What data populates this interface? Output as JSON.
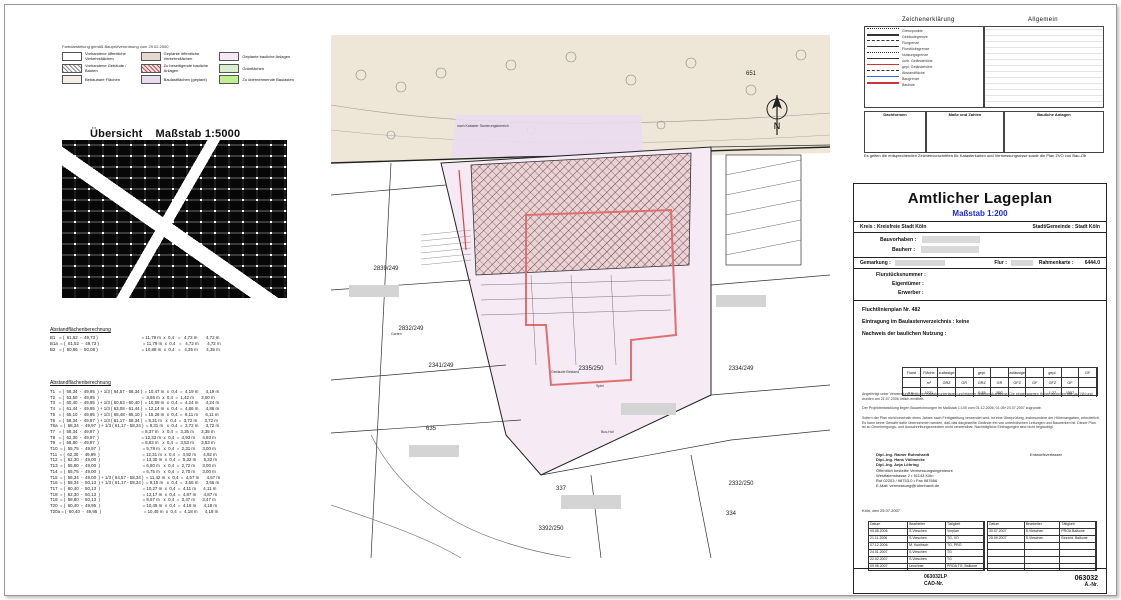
{
  "legend_left": {
    "header": "Farbdarstellung gemäß Bauprüfverordnung vom 29.02.2000",
    "items": [
      "Vorhandene öffentliche Verkehrsflächen",
      "Geplante öffentliche Verkehrsflächen",
      "Geplante bauliche Anlagen",
      "Vorhandene Gebäude / Bauten",
      "Zu beseitigende bauliche Anlagen",
      "Grünflächen",
      "Bebaubare Flächen",
      "Baulastflächen (geplant)",
      "Zu übernehmende Baulasten"
    ]
  },
  "overview": {
    "title": "Übersicht    Maßstab 1:5000"
  },
  "calc1": {
    "title": "Abstandflächenberechnung",
    "rows": [
      "B1   = (  61,52  -  49,73 )                                    = 11,79 m  x  0,4   =   4,72 m       4,72 m",
      "B1a  = (  61,52  -  49,73 )                                    = 11,79 m  x  0,4   =   4,72 m       4,72 m",
      "B2   = (  60,96  -  50,08 )                                    = 10,88 m  x  0,4   =   4,35 m       4,35 m"
    ]
  },
  "calc2": {
    "title": "Abstandflächenberechnung",
    "rows": [
      "T1   = (  58,34  -  49,95  ) + 1/3 ( 64,57 - 58,34 )  = 10,47 m  x  0,4  =  4,19 m      4,19 m",
      "T2   = (  53,50  -  49,95  )                                   =  3,55 m  x  0,4  =  1,42 m      3,00 m",
      "T3   = (  60,40  -  49,95  ) + 1/3 ( 60,63 - 60,40 )  = 10,59 m  x  0,4  =  4,24 m      4,24 m",
      "T4   = (  61,44  -  49,95  ) + 1/3 ( 63,08 - 61,44 )  = 12,14 m  x  0,4  =  4,86 m      4,86 m",
      "T5   = (  65,10  -  49,95  ) + 1/3 ( 65,48 - 65,10 )  = 15,28 m  x  0,4  =  6,11 m      6,11 m",
      "T6   = (  58,34  -  49,97  ) + 1/3 ( 61,17 - 58,34 )  = 9,31 m   x  0,4  =  3,72 m      3,72 m",
      "T6a  = (  58,34  -  49,97  ) + 1/3 ( 61,17 - 58,34 )  = 9,31 m   x  0,4  =  3,72 m      3,72 m",
      "T7   = (  58,34  -  49,97  )                                   = 8,37 m   x  0,4  =  3,35 m      3,35 m",
      "T8   = (  62,30  -  49,97  )                                   = 12,33 m  x  0,4  =  4,93 m      4,93 m",
      "T9   = (  58,80  -  49,97  )                                   = 8,83 m   x  0,4  =  3,53 m      3,53 m",
      "T10  = (  55,75  -  49,97  )                                   = 5,78 m   x  0,4  =  2,31 m      3,00 m",
      "T11  = (  62,30  -  49,99  )                                   = 12,31 m  x  0,4  =  4,92 m      4,92 m",
      "T12  = (  62,30  -  49,00  )                                   = 13,30 m  x  0,4  =  5,32 m      5,32 m",
      "T13  = (  55,80  -  49,00  )                                   = 6,80 m   x  0,4  =  2,72 m      3,00 m",
      "T14  = (  55,75  -  49,00  )                                   = 6,75 m   x  0,4  =  2,70 m      3,00 m",
      "T15  = (  58,34  -  49,00  ) + 1/3 ( 64,57 - 58,34 )  = 11,42 m  x  0,4  =  4,57 m      4,57 m",
      "T16  = (  58,34  -  50,13  ) + 1/3 ( 61,17 - 58,34 )  = 9,15 m   x  0,4  =  3,66 m      3,66 m",
      "T17  = (  60,40  -  50,13  )                                   = 10,27 m  x  0,4  =  4,11 m      4,11 m",
      "T18  = (  62,30  -  50,13  )                                   = 12,17 m  x  0,4  =  4,87 m      4,87 m",
      "T19  = (  58,80  -  50,13  )                                   = 8,67 m   x  0,4  =  3,47 m      3,47 m",
      "T20  = (  60,40  -  49,95  )                                   = 10,45 m  x  0,4  =  4,18 m      4,18 m",
      "T20a = (  60,40  -  49,95  )                                   = 10,45 m  x  0,4  =  4,18 m      4,18 m"
    ]
  },
  "legend_right": {
    "zeichen_title": "Zeichenerklärung",
    "allgemein_title": "Allgemein",
    "lines": [
      "Grenzpunkte",
      "Gebäudegrenze",
      "Flurgrenze",
      "Flurstücksgrenze",
      "Nutzungsgrenze",
      "vorh. Geländehöhe",
      "gepl. Geländehöhe",
      "Abstandfläche",
      "Baugrenze",
      "Baulinie"
    ],
    "dachformen_title": "Dachformen",
    "masse_title": "Maße und Zahlen",
    "bauliche_title": "Bauliche Anlagen",
    "footnote": "Es gelten die entsprechenden Zeichenvorschriften für Katasterkarten und Vermessungsrisse sowie die Plan ZVO von Bau-Ob"
  },
  "plan": {
    "labels": [
      "651",
      "2839/249",
      "2832/249",
      "2341/249",
      "2335/250",
      "2334/249",
      "635",
      "337",
      "3392/250",
      "2332/250",
      "334"
    ],
    "notes": [
      "nach Kataster Sanierungsbereich",
      "Gebäude Bestand",
      "Bus-Hof",
      "Garten",
      "Spiel"
    ]
  },
  "title_block": {
    "title": "Amtlicher Lageplan",
    "scale": "Maßstab 1:200",
    "kreis": "Kreis : Kreisfreie Stadt Köln",
    "gemeinde": "Stadt/Gemeinde :  Stadt Köln",
    "bauvorhaben": "Bauvorhaben :",
    "bauherr": "Bauherr :",
    "gemarkung": "Gemarkung :",
    "flur": "Flur :",
    "rahmenkarte": "Rahmenkarte :        6444.0",
    "flurstueck": "Flurstücksnummer :",
    "eigentuemer": "Eigentümer :",
    "erwerber": "Erwerber :",
    "fluchtlinien": "Fluchtlinienplan Nr. 482",
    "baulast": "Eintragung im Baulastenverzeichnis :   keine",
    "nachweis": "Nachweis der baulichen Nutzung :",
    "nutz_head": [
      "Flurst",
      "Fläche",
      "zulässige",
      "",
      "gepl.",
      "",
      "zulässige",
      "",
      "gepl.",
      "",
      "GF"
    ],
    "nutz_head2": [
      "",
      "m²",
      "GRZ",
      "GR",
      "GRZ",
      "GR",
      "GFZ",
      "GF",
      "GFZ",
      "GF",
      ""
    ],
    "nutz_vals": [
      "s.u.",
      "1221",
      "-",
      "-",
      "0,33",
      "392",
      "-",
      "-",
      "1,27",
      "1557",
      ""
    ],
    "para1": "Angefertigt unter Verwendung amtlicher Katasterunterlagen und eigener örtlicher Aufnahme. Die eingetragenen Höhen beziehen sich auf NN und wurden am 21.07.2006 örtlich ermittelt.",
    "para2": "Der Projektentwicklung liegen Bauzeichnungen im Maßstab 1:100 vom 01.12.2006, 01.06+23.07.2007 zugrunde.",
    "para3": "Sofern der Plan nicht innerhalb eines Jahres nach Fertigstellung verwendet wird, ist eine Überprüfung, insbesondere der Höhenangaben, erforderlich. Es kann keine Gewähr dafür übernommen werden, daß das dargestellte Gelände frei von unterirdischen Leitungen und Bauwerken ist. Dieser Plan ist zu Genehmigungs- und Ausschreibungszwecken nicht verwendbar. Nachträgliche Eintragungen sind nicht beglaubigt.",
    "sign_name1": "Dipl.-Ing. Rainer Ruhmhardt",
    "sign_name2": "Dipl.-Ing. Hans Völlmecke",
    "sign_name3": "Dipl.-Ing. Anja Löhring",
    "sign_office": "Öffentlich bestellte Vermessungsingenieure",
    "sign_addr": "Westfalenstrasse 2 • 51143 Köln",
    "sign_tel": "Ruf 02203 / 98753-0 • Fax 987666",
    "sign_mail": "E-Mail: vermessung@ruhmhardt.de",
    "entwurf": "Entwurfsverfasser",
    "ort_datum": "Köln, den 25.07.2007",
    "hist_head": [
      "Datum",
      "Bearbeiter",
      "Tätigkeit"
    ],
    "hist_rows_left": [
      [
        "09.08.2006",
        "S.Vieschen",
        "Vorplan"
      ],
      [
        "21.11.2006",
        "S.Vieschen",
        "TG, VO"
      ],
      [
        "07.12.2006",
        "M. Kunibsch",
        "TG, PRO"
      ],
      [
        "24.01.2007",
        "S.Vieschen",
        "TG"
      ],
      [
        "22.02.2007",
        "S.Vieschen",
        "TG"
      ],
      [
        "09.06.2007",
        "Leuchner",
        "PROA TG, Balkone"
      ]
    ],
    "hist_rows_right": [
      [
        "30.07.2007",
        "S.Vieschen",
        "PROA Balkone"
      ],
      [
        "25.09.2007",
        "S.Vieschen",
        "Einricht. Balkone"
      ],
      [
        "",
        "",
        ""
      ],
      [
        "",
        "",
        ""
      ],
      [
        "",
        "",
        ""
      ],
      [
        "",
        "",
        ""
      ]
    ],
    "foot_left": "063032LP",
    "foot_cad": "CAD-Nr.",
    "foot_num": "063032",
    "foot_anr": "Ä.-Nr."
  }
}
